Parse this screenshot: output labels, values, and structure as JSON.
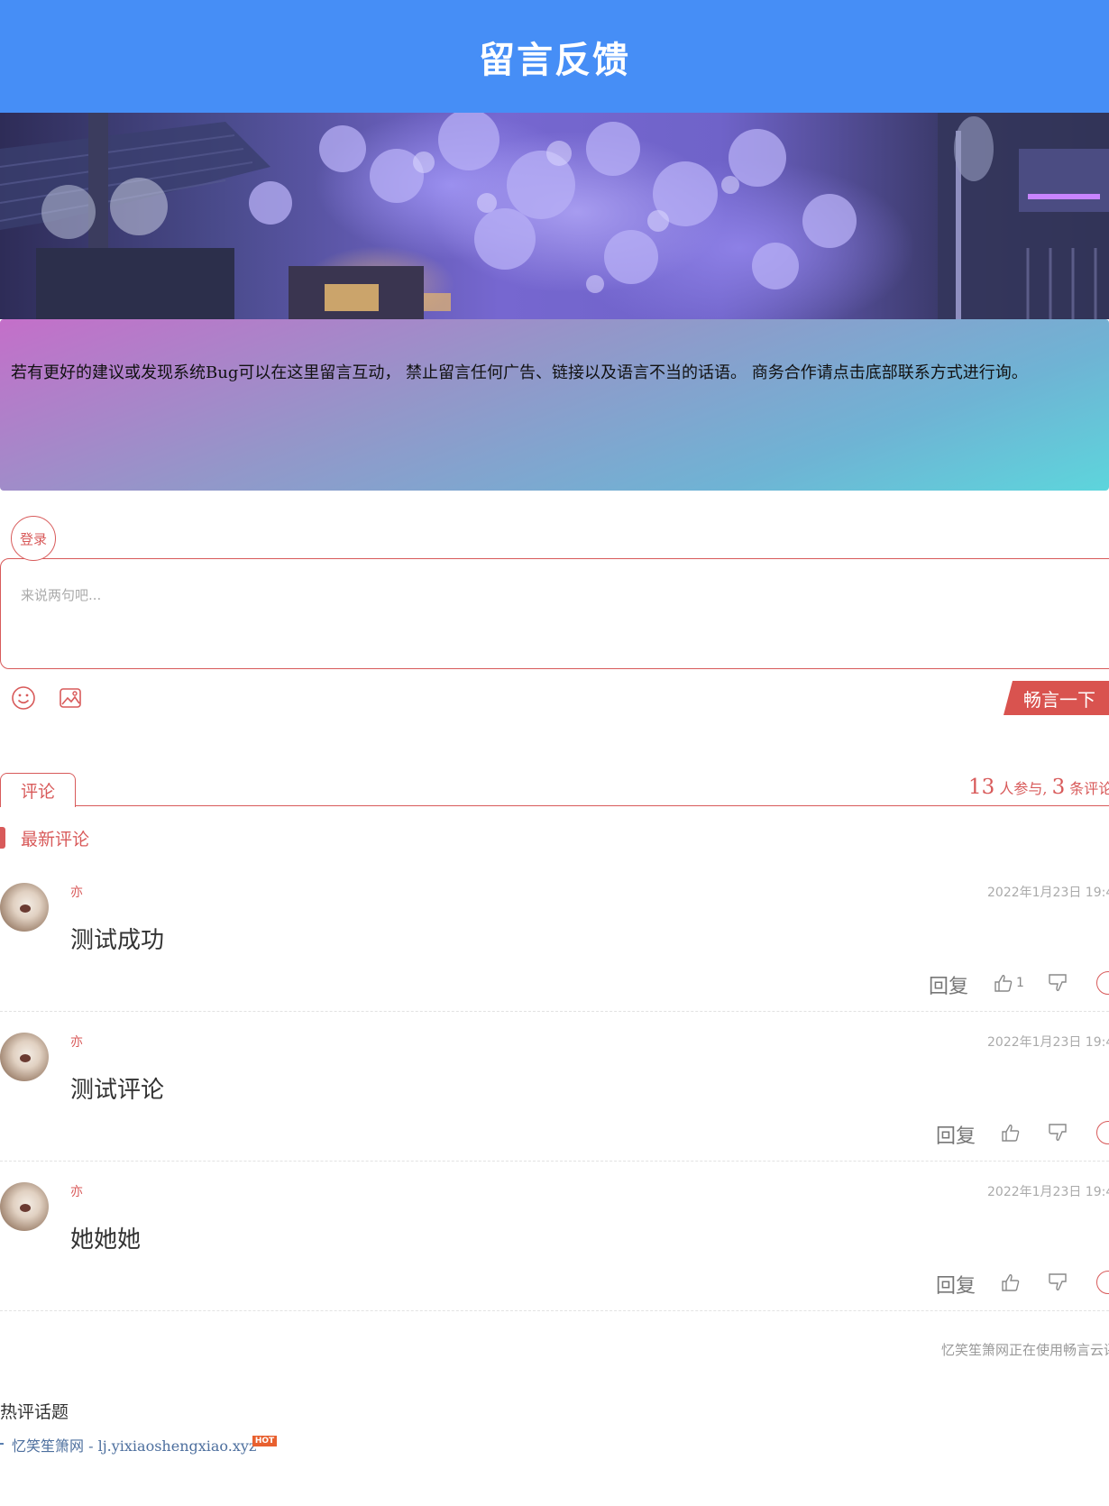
{
  "header": {
    "title": "留言反馈"
  },
  "notice": {
    "text": "若有更好的建议或发现系统Bug可以在这里留言互动， 禁止留言任何广告、链接以及语言不当的话语。 商务合作请点击底部联系方式进行询。"
  },
  "editor": {
    "login_label": "登录",
    "placeholder": "来说两句吧...",
    "submit_label": "畅言一下",
    "tool_icons": [
      "smiley-icon",
      "image-icon"
    ]
  },
  "tabs": {
    "comment_label": "评论"
  },
  "stats": {
    "participants": "13",
    "participants_suffix": "人参与,",
    "comments": "3",
    "comments_suffix": "条评论"
  },
  "section": {
    "latest_label": "最新评论"
  },
  "comments": [
    {
      "user": "亦",
      "time": "2022年1月23日 19:4",
      "content": "测试成功",
      "reply_label": "回复",
      "likes": "1"
    },
    {
      "user": "亦",
      "time": "2022年1月23日 19:4",
      "content": "测试评论",
      "reply_label": "回复",
      "likes": ""
    },
    {
      "user": "亦",
      "time": "2022年1月23日 19:4",
      "content": "她她她",
      "reply_label": "回复",
      "likes": ""
    }
  ],
  "footer": {
    "powered_by": "忆笑笙箫网正在使用畅言云评",
    "hot_title": "热评话题",
    "hot_link": "忆笑笙箫网 - lj.yixiaoshengxiao.xyz",
    "hot_badge": "HOT"
  },
  "colors": {
    "header": "#468ef6",
    "accent": "#d85a5a"
  }
}
